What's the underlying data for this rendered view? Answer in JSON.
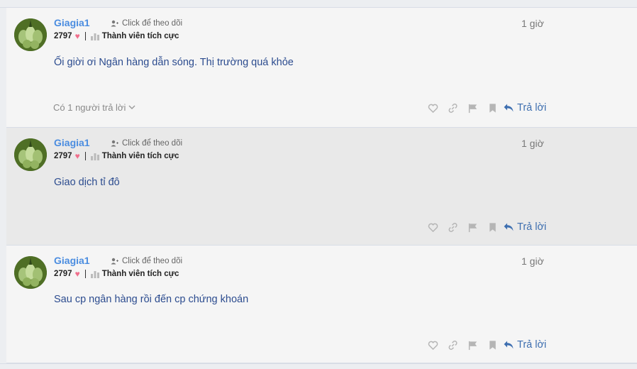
{
  "posts": [
    {
      "username": "Giagia1",
      "follow_label": "Click để theo dõi",
      "points": "2797",
      "rank": "Thành viên tích cực",
      "time": "1 giờ",
      "content": "Ối giời ơi Ngân hàng dẫn sóng. Thị trường quá khỏe",
      "replies_label": "Có 1 người trả lời",
      "reply_label": "Trả lời",
      "highlighted": false
    },
    {
      "username": "Giagia1",
      "follow_label": "Click để theo dõi",
      "points": "2797",
      "rank": "Thành viên tích cực",
      "time": "1 giờ",
      "content": "Giao dịch tỉ đô",
      "reply_label": "Trả lời",
      "highlighted": true
    },
    {
      "username": "Giagia1",
      "follow_label": "Click để theo dõi",
      "points": "2797",
      "rank": "Thành viên tích cực",
      "time": "1 giờ",
      "content": "Sau cp ngân hàng rồi đến cp chứng khoán",
      "reply_label": "Trả lời",
      "highlighted": false
    }
  ],
  "colors": {
    "username": "#4b8de0",
    "content": "#2c4c8f",
    "heart": "#f06e8b",
    "reply": "#3e6fb0"
  }
}
